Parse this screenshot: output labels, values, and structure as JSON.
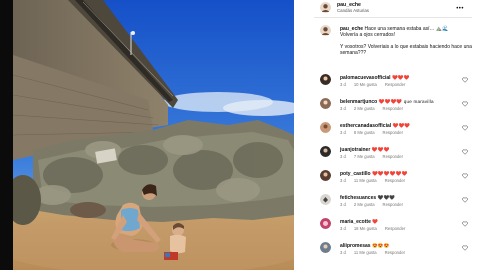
{
  "post": {
    "username": "pau_eche",
    "location": "Candás Asturias"
  },
  "caption": {
    "username": "pau_eche",
    "line1": "Hace una semana estaba así…",
    "line2": "Volvería a ojos cerrados!",
    "line3": "Y vosotros? Volveriais a lo que estabais haciendo hace una",
    "line4": "semana???"
  },
  "comments": [
    {
      "username": "palomacuevasofficial",
      "text": "❤️❤️❤️",
      "time": "3 d",
      "likes": "10 Me gusta",
      "reply": "Responder",
      "avatar_color": "#3a2b25"
    },
    {
      "username": "belenmartjunco",
      "text": "❤️❤️❤️❤️ que maravilla",
      "time": "3 d",
      "likes": "2 Me gusta",
      "reply": "Responder",
      "avatar_color": "#8a6a55"
    },
    {
      "username": "esthercanadasofficial",
      "text": "❤️❤️❤️",
      "time": "3 d",
      "likes": "8 Me gusta",
      "reply": "Responder",
      "avatar_color": "#c99a7a"
    },
    {
      "username": "juanjotrainer",
      "text": "❤️❤️❤️",
      "time": "3 d",
      "likes": "7 Me gusta",
      "reply": "Responder",
      "avatar_color": "#2b2b2b"
    },
    {
      "username": "poty_castillo",
      "text": "❤️❤️❤️❤️❤️❤️",
      "time": "3 d",
      "likes": "11 Me gusta",
      "reply": "Responder",
      "avatar_color": "#5a3d30"
    },
    {
      "username": "fetichesuances",
      "text": "🖤🖤🖤",
      "time": "3 d",
      "likes": "2 Me gusta",
      "reply": "Responder",
      "avatar_color": "#d9d6cf"
    },
    {
      "username": "maria_ecotte",
      "text": "❤️",
      "time": "3 d",
      "likes": "18 Me gusta",
      "reply": "Responder",
      "avatar_color": "#c2426b"
    },
    {
      "username": "aliipromesas",
      "text": "😍😍😍",
      "time": "3 d",
      "likes": "11 Me gusta",
      "reply": "Responder",
      "avatar_color": "#6d7d8f"
    }
  ],
  "icons": {
    "more": "more-options-icon",
    "heart": "heart-icon",
    "next": "chevron-right-icon"
  }
}
